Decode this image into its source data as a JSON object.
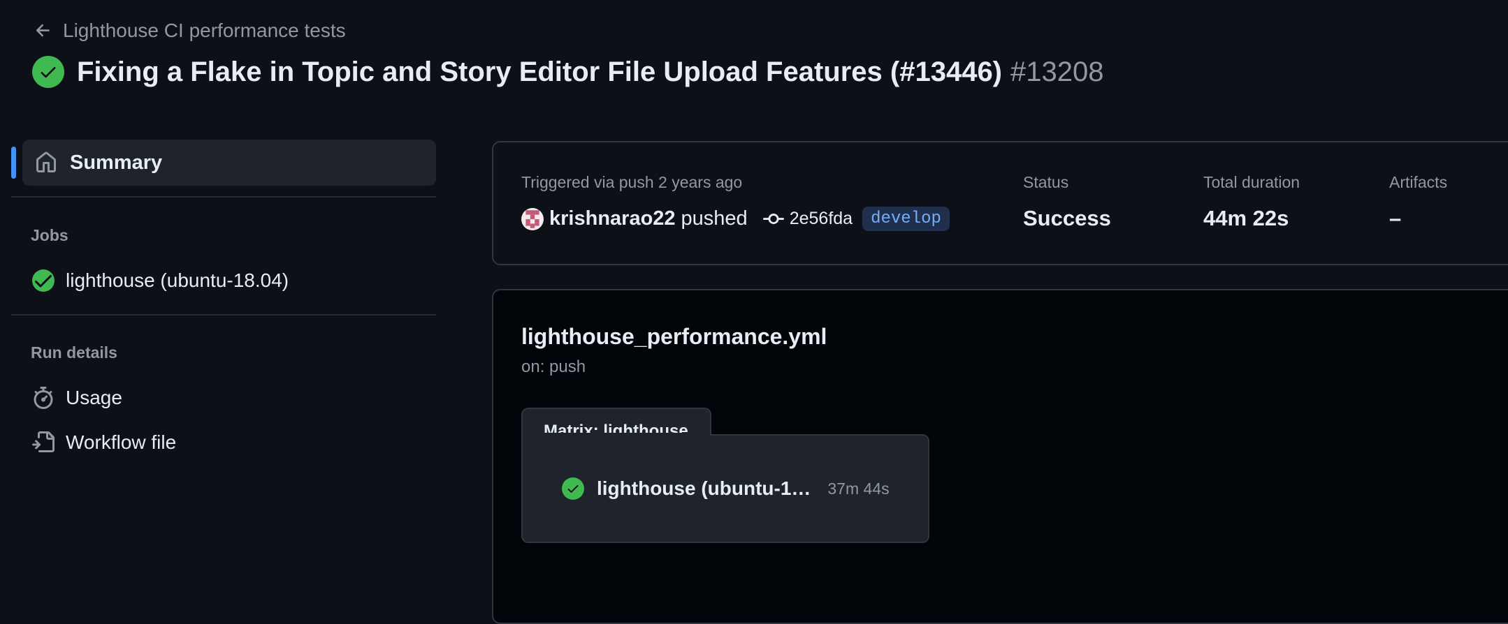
{
  "header": {
    "back_label": "Lighthouse CI performance tests",
    "title": "Fixing a Flake in Topic and Story Editor File Upload Features (#13446)",
    "run_number": "#13208"
  },
  "sidebar": {
    "summary_label": "Summary",
    "jobs_heading": "Jobs",
    "jobs": [
      {
        "label": "lighthouse (ubuntu-18.04)",
        "status": "success"
      }
    ],
    "run_details_heading": "Run details",
    "run_details": [
      {
        "label": "Usage",
        "icon": "stopwatch-icon"
      },
      {
        "label": "Workflow file",
        "icon": "file-code-icon"
      }
    ]
  },
  "summary": {
    "triggered": "Triggered via push 2 years ago",
    "pusher": "krishnarao22",
    "pushed_word": "pushed",
    "commit": "2e56fda",
    "branch": "develop",
    "status_label": "Status",
    "status_value": "Success",
    "duration_label": "Total duration",
    "duration_value": "44m 22s",
    "artifacts_label": "Artifacts",
    "artifacts_value": "–"
  },
  "workflow": {
    "file": "lighthouse_performance.yml",
    "trigger": "on: push",
    "matrix_label": "Matrix: lighthouse",
    "job_name": "lighthouse (ubuntu-1…",
    "job_duration": "37m 44s"
  },
  "colors": {
    "background": "#0d1117",
    "success": "#3fb950",
    "accent": "#4493f8",
    "muted": "#9198a1"
  }
}
